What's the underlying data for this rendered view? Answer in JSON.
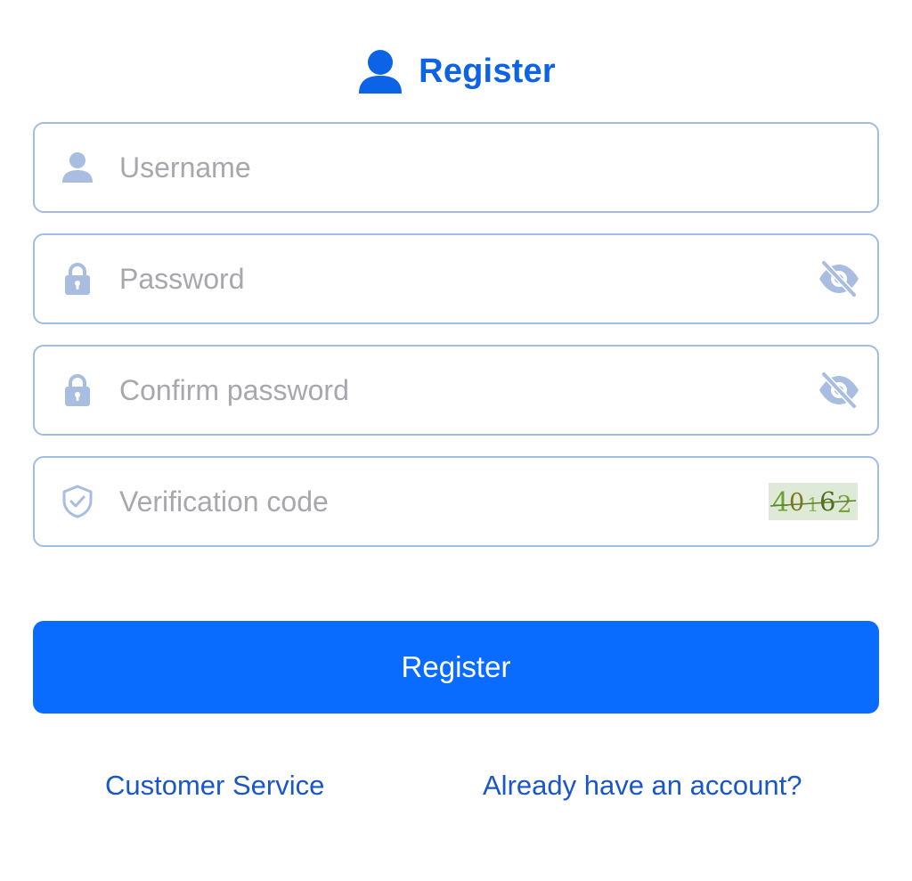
{
  "header": {
    "title": "Register",
    "icon": "user-icon",
    "accent_color": "#0d63e6"
  },
  "form": {
    "username": {
      "placeholder": "Username",
      "value": "",
      "icon": "user-icon"
    },
    "password": {
      "placeholder": "Password",
      "value": "",
      "icon": "lock-icon",
      "toggle_icon": "eye-off-icon"
    },
    "confirm_password": {
      "placeholder": "Confirm password",
      "value": "",
      "icon": "lock-icon",
      "toggle_icon": "eye-off-icon"
    },
    "verification": {
      "placeholder": "Verification code",
      "value": "",
      "icon": "shield-check-icon",
      "captcha_digits": [
        "4",
        "0",
        "1",
        "6",
        "2"
      ]
    }
  },
  "actions": {
    "register_label": "Register",
    "button_color": "#0a6cff"
  },
  "footer": {
    "customer_service": "Customer Service",
    "login_prompt": "Already have an account?"
  }
}
